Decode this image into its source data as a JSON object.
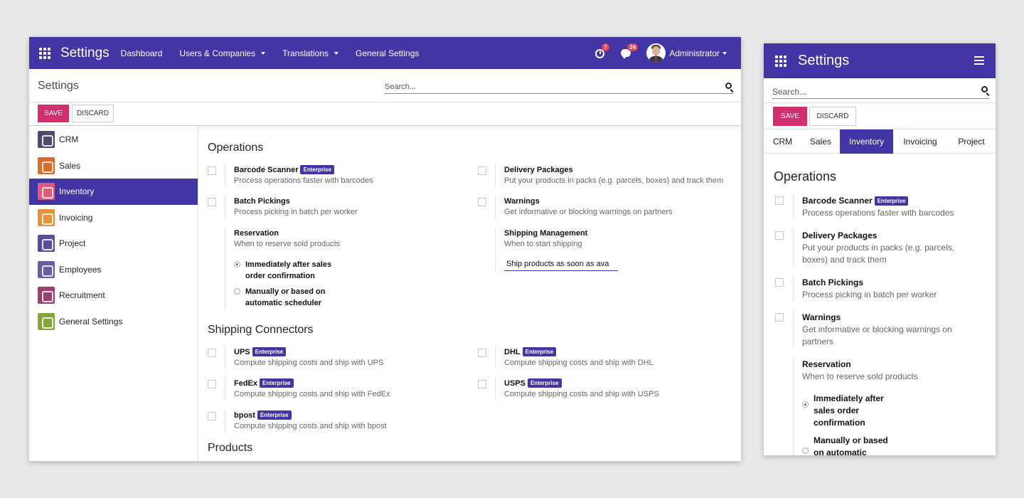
{
  "desktop": {
    "topbar": {
      "brand": "Settings",
      "menu": [
        "Dashboard",
        "Users & Companies",
        "Translations",
        "General Settings"
      ],
      "activity_count": "7",
      "message_count": "24",
      "user": "Administrator"
    },
    "control_panel": {
      "title": "Settings",
      "search_placeholder": "Search...",
      "save_label": "SAVE",
      "discard_label": "DISCARD"
    },
    "sidebar": [
      {
        "label": "CRM",
        "color": "#4d4a6e",
        "icon": "handshake-icon"
      },
      {
        "label": "Sales",
        "color": "#d96b2b",
        "icon": "chart-icon"
      },
      {
        "label": "Inventory",
        "color": "#e2597a",
        "icon": "box-icon"
      },
      {
        "label": "Invoicing",
        "color": "#e8913b",
        "icon": "invoice-icon"
      },
      {
        "label": "Project",
        "color": "#5b4c9a",
        "icon": "puzzle-icon"
      },
      {
        "label": "Employees",
        "color": "#6b5ca8",
        "icon": "people-icon"
      },
      {
        "label": "Recruitment",
        "color": "#9b3f6e",
        "icon": "magnifier-icon"
      },
      {
        "label": "General Settings",
        "color": "#87a33a",
        "icon": "gear-icon"
      }
    ],
    "operations": {
      "title": "Operations",
      "barcode": {
        "title": "Barcode Scanner",
        "badge": "Enterprise",
        "desc": "Process operations faster with barcodes"
      },
      "delivery": {
        "title": "Delivery Packages",
        "desc": "Put your products in packs (e.g. parcels, boxes) and track them"
      },
      "batch": {
        "title": "Batch Pickings",
        "desc": "Process picking in batch per worker"
      },
      "warnings": {
        "title": "Warnings",
        "desc": "Get informative or blocking warnings on partners"
      },
      "reservation": {
        "title": "Reservation",
        "desc": "When to reserve sold products",
        "option1_line1": "Immediately after sales",
        "option1_line2": "order confirmation",
        "option2_line1": "Manually or based on",
        "option2_line2": "automatic scheduler"
      },
      "shipping_mgmt": {
        "title": "Shipping Management",
        "desc": "When to start shipping",
        "value": "Ship products as soon as ava"
      }
    },
    "connectors": {
      "title": "Shipping Connectors",
      "ups": {
        "title": "UPS",
        "badge": "Enterprise",
        "desc": "Compute shipping costs and ship with UPS"
      },
      "dhl": {
        "title": "DHL",
        "badge": "Enterprise",
        "desc": "Compute shipping costs and ship with DHL"
      },
      "fedex": {
        "title": "FedEx",
        "badge": "Enterprise",
        "desc": "Compute shipping costs and ship with FedEx"
      },
      "usps": {
        "title": "USPS",
        "badge": "Enterprise",
        "desc": "Compute shipping costs and ship with USPS"
      },
      "bpost": {
        "title": "bpost",
        "badge": "Enterprise",
        "desc": "Compute shipping costs and ship with bpost"
      }
    },
    "products": {
      "title": "Products"
    }
  },
  "mobile": {
    "brand": "Settings",
    "search_placeholder": "Search...",
    "save_label": "SAVE",
    "discard_label": "DISCARD",
    "tabs": [
      "CRM",
      "Sales",
      "Inventory",
      "Invoicing",
      "Project"
    ],
    "operations_title": "Operations",
    "barcode": {
      "title": "Barcode Scanner",
      "badge": "Enterprise",
      "desc": "Process operations faster with barcodes"
    },
    "delivery": {
      "title": "Delivery Packages",
      "desc": "Put your products in packs (e.g. parcels, boxes) and track them"
    },
    "batch": {
      "title": "Batch Pickings",
      "desc": "Process picking in batch per worker"
    },
    "warnings": {
      "title": "Warnings",
      "desc": "Get informative or blocking warnings on partners"
    },
    "reservation": {
      "title": "Reservation",
      "desc": "When to reserve sold products",
      "option1_line1": "Immediately after",
      "option1_line2": "sales order",
      "option1_line3": "confirmation",
      "option2_line1": "Manually or based",
      "option2_line2": "on automatic"
    }
  },
  "colors": {
    "primary": "#4236a6",
    "save": "#d22f6f",
    "badge": "#4236a6"
  }
}
